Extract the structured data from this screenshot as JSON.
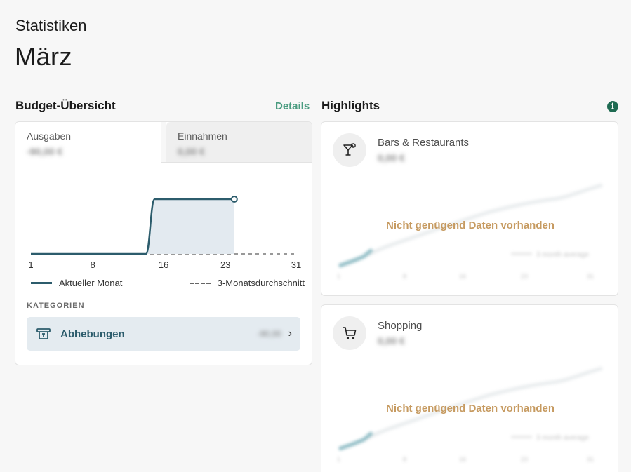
{
  "header": {
    "subtitle": "Statistiken",
    "title": "März"
  },
  "budget": {
    "title": "Budget-Übersicht",
    "details_label": "Details",
    "tabs": [
      {
        "label": "Ausgaben",
        "amount": "-90,00 €"
      },
      {
        "label": "Einnahmen",
        "amount": "0,00 €"
      }
    ],
    "legend": {
      "current": "Aktueller Monat",
      "average": "3-Monatsdurchschnitt"
    },
    "categories_label": "KATEGORIEN",
    "categories": [
      {
        "name": "Abhebungen",
        "amount": "-90,00",
        "icon": "atm-icon"
      }
    ]
  },
  "highlights": {
    "title": "Highlights",
    "info_icon": "info-icon",
    "items": [
      {
        "name": "Bars & Restaurants",
        "amount": "0,00 €",
        "icon": "cocktail-icon",
        "message": "Nicht genügend Daten vorhanden",
        "ghost_label": "3 month average"
      },
      {
        "name": "Shopping",
        "amount": "0,00 €",
        "icon": "cart-icon",
        "message": "Nicht genügend Daten vorhanden",
        "ghost_label": "3 month average"
      }
    ]
  },
  "chart_data": {
    "type": "area",
    "x_ticks": [
      1,
      8,
      16,
      23,
      31
    ],
    "xlim": [
      1,
      31
    ],
    "series": [
      {
        "name": "Aktueller Monat",
        "x": [
          1,
          14,
          15,
          24
        ],
        "y": [
          0,
          0,
          90,
          90
        ]
      },
      {
        "name": "3-Monatsdurchschnitt",
        "x": [
          1,
          31
        ],
        "y": [
          0,
          0
        ]
      }
    ],
    "colors": {
      "current": "#2c5c6c",
      "fill": "#e3eaf0",
      "average": "#999999"
    }
  }
}
